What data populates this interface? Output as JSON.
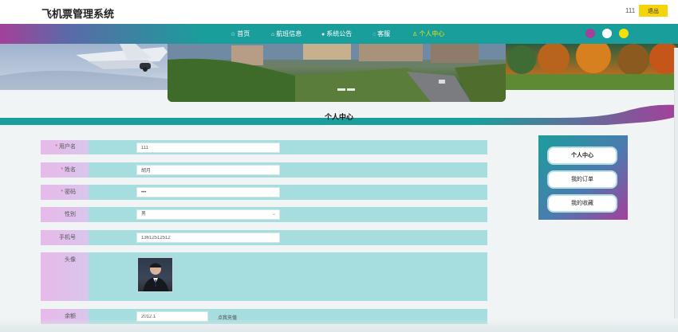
{
  "header": {
    "site_title": "飞机票管理系统",
    "user_name": "111",
    "logout_label": "退出"
  },
  "nav": {
    "items": [
      {
        "label": "首页",
        "icon": "star-icon"
      },
      {
        "label": "航班信息",
        "icon": "lock-icon"
      },
      {
        "label": "系统公告",
        "icon": "circle-icon"
      },
      {
        "label": "客服",
        "icon": "headset-icon"
      },
      {
        "label": "个人中心",
        "icon": "person-icon",
        "active": true
      }
    ],
    "theme_dots": [
      "#a3409a",
      "#ffffff",
      "#f5e10a"
    ]
  },
  "section": {
    "title": "个人中心"
  },
  "form": {
    "username": {
      "label": "用户名",
      "value": "111",
      "required": true
    },
    "name": {
      "label": "姓名",
      "value": "胡月",
      "required": true
    },
    "password": {
      "label": "密码",
      "value": "•••",
      "required": true
    },
    "gender": {
      "label": "性别",
      "value": "男",
      "options_visible": [
        "男"
      ]
    },
    "phone": {
      "label": "手机号",
      "value": "13612512512"
    },
    "avatar": {
      "label": "头像"
    },
    "balance": {
      "label": "余额",
      "value": "2012.1",
      "action": "点我充值"
    }
  },
  "side_menu": {
    "items": [
      "个人中心",
      "我的订单",
      "我的收藏"
    ]
  },
  "colors": {
    "accent_teal": "#1a9e9b",
    "accent_purple": "#a3409a",
    "accent_yellow": "#f5d409",
    "row_bg": "#a6dddf"
  }
}
